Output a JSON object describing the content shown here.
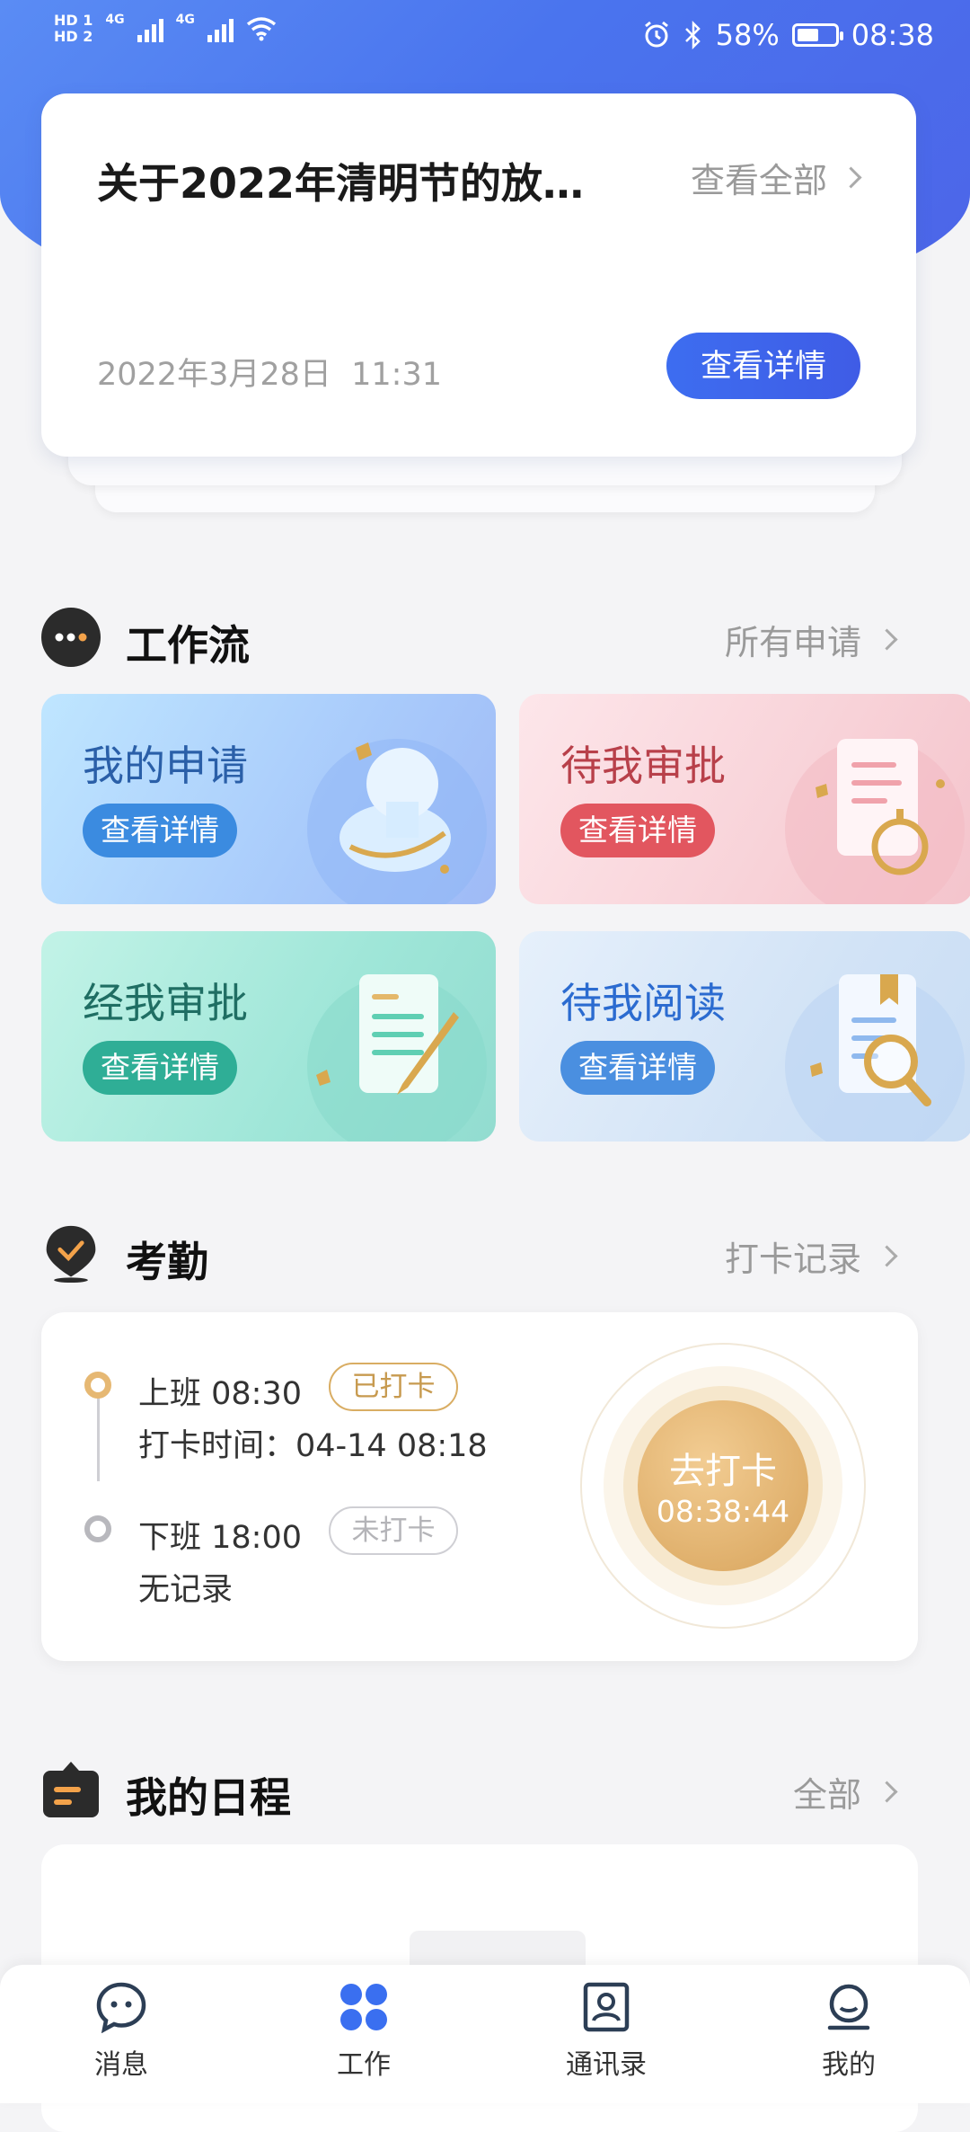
{
  "status_bar": {
    "hd1": "HD 1",
    "hd2": "HD 2",
    "net1": "4G",
    "net2": "4G",
    "battery": "58%",
    "battery_level": 0.58,
    "time": "08:38"
  },
  "notice": {
    "title": "关于2022年清明节的放…",
    "view_all": "查看全部",
    "date": "2022年3月28日  11:31",
    "detail_button": "查看详情"
  },
  "workflow": {
    "title": "工作流",
    "link": "所有申请",
    "tiles": [
      {
        "title": "我的申请",
        "button": "查看详情",
        "accent": "#3b8be0",
        "title_color": "#2a5fa8"
      },
      {
        "title": "待我审批",
        "button": "查看详情",
        "accent": "#e2565f",
        "title_color": "#b8404a"
      },
      {
        "title": "经我审批",
        "button": "查看详情",
        "accent": "#2fae96",
        "title_color": "#1f6e63"
      },
      {
        "title": "待我阅读",
        "button": "查看详情",
        "accent": "#4a8fe0",
        "title_color": "#2b6bd0"
      }
    ]
  },
  "attendance": {
    "title": "考勤",
    "link": "打卡记录",
    "on_duty": {
      "label": "上班 08:30",
      "tag": "已打卡",
      "detail": "打卡时间：04-14 08:18"
    },
    "off_duty": {
      "label": "下班 18:00",
      "tag": "未打卡",
      "detail": "无记录"
    },
    "punch_button": "去打卡",
    "punch_time": "08:38:44"
  },
  "schedule": {
    "title": "我的日程",
    "link": "全部"
  },
  "tabbar": {
    "items": [
      {
        "label": "消息",
        "icon": "message-icon"
      },
      {
        "label": "工作",
        "icon": "work-icon",
        "active": true
      },
      {
        "label": "通讯录",
        "icon": "contacts-icon"
      },
      {
        "label": "我的",
        "icon": "profile-icon"
      }
    ],
    "active_color": "#3a6ff0"
  }
}
